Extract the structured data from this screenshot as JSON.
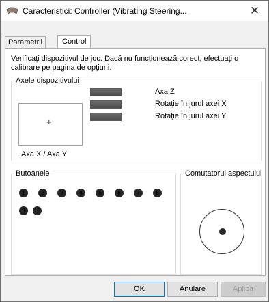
{
  "window": {
    "title": "Caracteristici: Controller (Vibrating Steering...",
    "close_glyph": "✕",
    "icon": "gamepad-icon"
  },
  "tabs": [
    {
      "label": "Parametrii",
      "active": false
    },
    {
      "label": "Control",
      "active": true
    }
  ],
  "description": "Verificați dispozitivul de joc. Dacă nu funcționează corect, efectuați o calibrare pe pagina de opțiuni.",
  "axes_group": {
    "label": "Axele dispozitivului",
    "xy_label": "Axa X / Axa Y",
    "xy_marker": "+",
    "axes": [
      {
        "label": "Axa Z"
      },
      {
        "label": "Rotație în jurul axei X"
      },
      {
        "label": "Rotație în jurul axei Y"
      }
    ]
  },
  "buttons_group": {
    "label": "Butoanele",
    "buttons": [
      "1",
      "2",
      "3",
      "4",
      "5",
      "6",
      "7",
      "8",
      "9",
      "10"
    ]
  },
  "pov_group": {
    "label": "Comutatorul aspectului"
  },
  "footer": {
    "ok": "OK",
    "cancel": "Anulare",
    "apply": "Aplică"
  },
  "colors": {
    "accent": "#0078d7",
    "window_bg": "#f0f0f0",
    "panel_bg": "#ffffff"
  }
}
